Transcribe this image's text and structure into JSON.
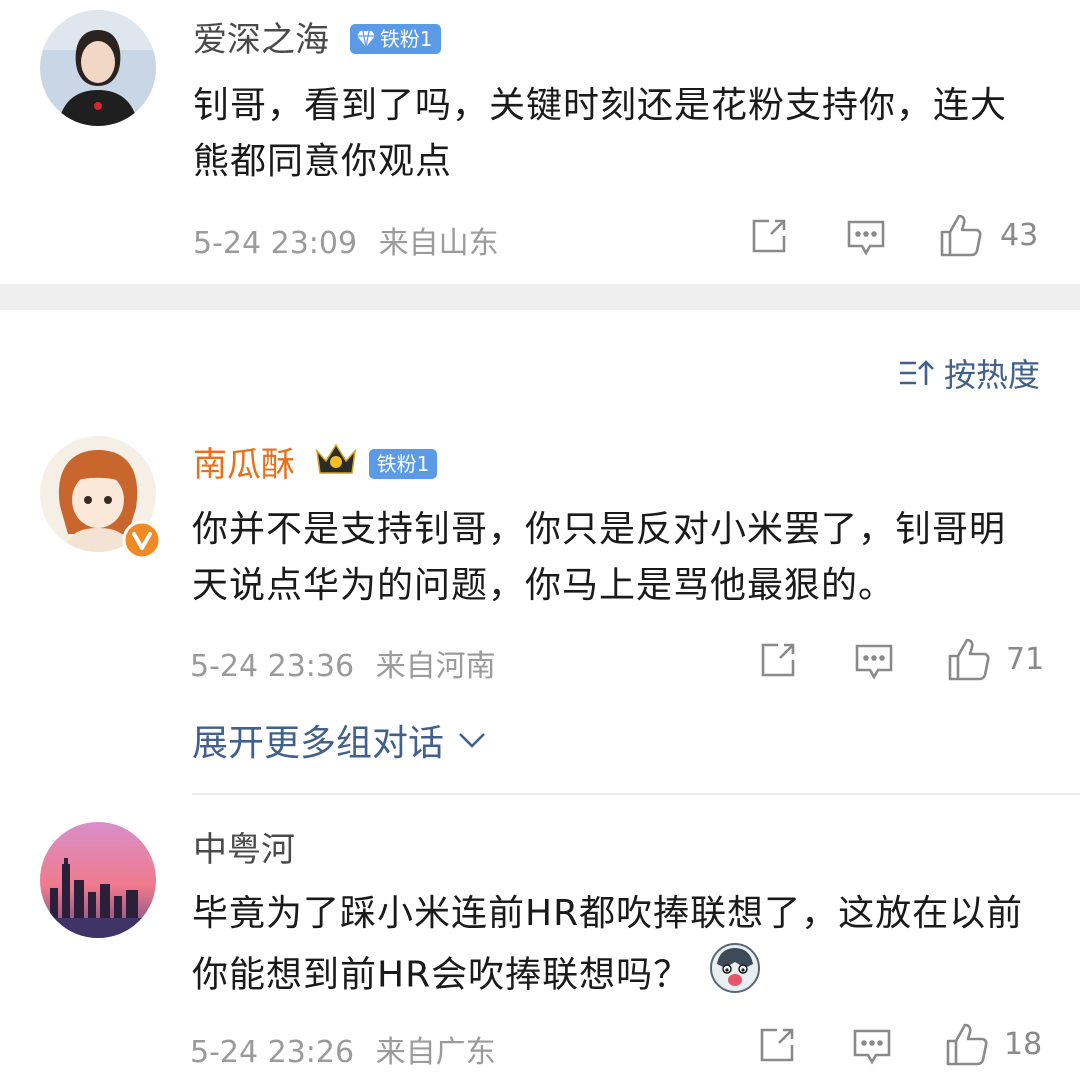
{
  "comments": [
    {
      "username": "爱深之海",
      "badge": "铁粉1",
      "text": "钊哥，看到了吗，关键时刻还是花粉支持你，连大熊都同意你观点",
      "time": "5-24 23:09",
      "location": "来自山东",
      "likes": "43",
      "name_color": "#4a4a4a"
    },
    {
      "username": "南瓜酥",
      "badge": "铁粉1",
      "text": "你并不是支持钊哥，你只是反对小米罢了，钊哥明天说点华为的问题，你马上是骂他最狠的。",
      "time": "5-24 23:36",
      "location": "来自河南",
      "likes": "71",
      "name_color": "#e8701a"
    },
    {
      "username": "中粤河",
      "text": "毕竟为了踩小米连前HR都吹捧联想了，这放在以前你能想到前HR会吹捧联想吗？",
      "time": "5-24 23:26",
      "location": "来自广东",
      "likes": "18",
      "name_color": "#4a4a4a"
    }
  ],
  "sort_label": "按热度",
  "expand_label": "展开更多组对话",
  "colors": {
    "link": "#42618a",
    "badge": "#5a9ae6",
    "meta": "#9b9b9b"
  }
}
